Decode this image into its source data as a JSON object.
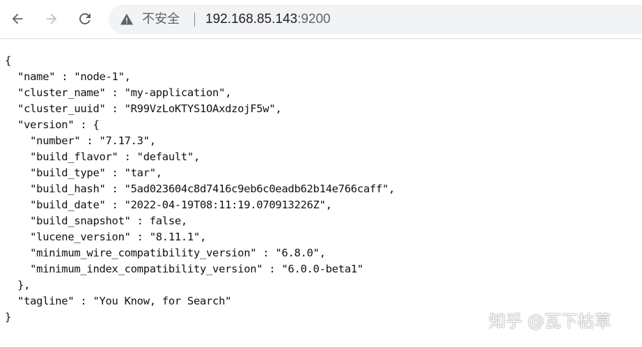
{
  "toolbar": {
    "back_icon": "arrow-left-icon",
    "forward_icon": "arrow-right-icon",
    "reload_icon": "reload-icon",
    "security_icon": "warning-triangle-icon",
    "security_label": "不安全",
    "url_host": "192.168.85.143",
    "url_port": ":9200"
  },
  "json_lines": [
    "{",
    "  \"name\" : \"node-1\",",
    "  \"cluster_name\" : \"my-application\",",
    "  \"cluster_uuid\" : \"R99VzLoKTYS1OAxdzojF5w\",",
    "  \"version\" : {",
    "    \"number\" : \"7.17.3\",",
    "    \"build_flavor\" : \"default\",",
    "    \"build_type\" : \"tar\",",
    "    \"build_hash\" : \"5ad023604c8d7416c9eb6c0eadb62b14e766caff\",",
    "    \"build_date\" : \"2022-04-19T08:11:19.070913226Z\",",
    "    \"build_snapshot\" : false,",
    "    \"lucene_version\" : \"8.11.1\",",
    "    \"minimum_wire_compatibility_version\" : \"6.8.0\",",
    "    \"minimum_index_compatibility_version\" : \"6.0.0-beta1\"",
    "  },",
    "  \"tagline\" : \"You Know, for Search\"",
    "}"
  ],
  "watermark": "知乎 @瓦下枯草",
  "colors": {
    "toolbar_bg": "#ffffff",
    "omnibox_bg": "#f1f3f4",
    "icon": "#5f6368",
    "text": "#111111"
  }
}
